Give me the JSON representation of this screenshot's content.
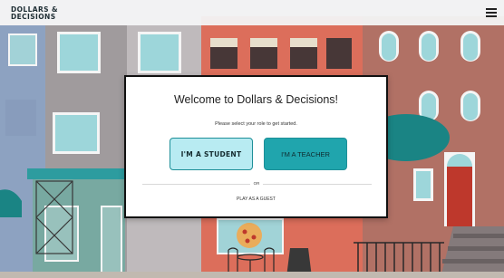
{
  "header": {
    "logo_line1": "DOLLARS &",
    "logo_line2": "DECISIONS",
    "menu_icon": "hamburger-menu-icon"
  },
  "modal": {
    "title": "Welcome to Dollars & Decisions!",
    "subtitle": "Please select your role to get started.",
    "student_button": "I'M A STUDENT",
    "teacher_button": "I'M A TEACHER",
    "or_label": "OR",
    "guest_link": "PLAY AS A GUEST"
  },
  "colors": {
    "student_button_bg": "#b8ebf2",
    "teacher_button_bg": "#20a5ad",
    "button_border": "#1d8f98",
    "modal_border": "#111111"
  }
}
